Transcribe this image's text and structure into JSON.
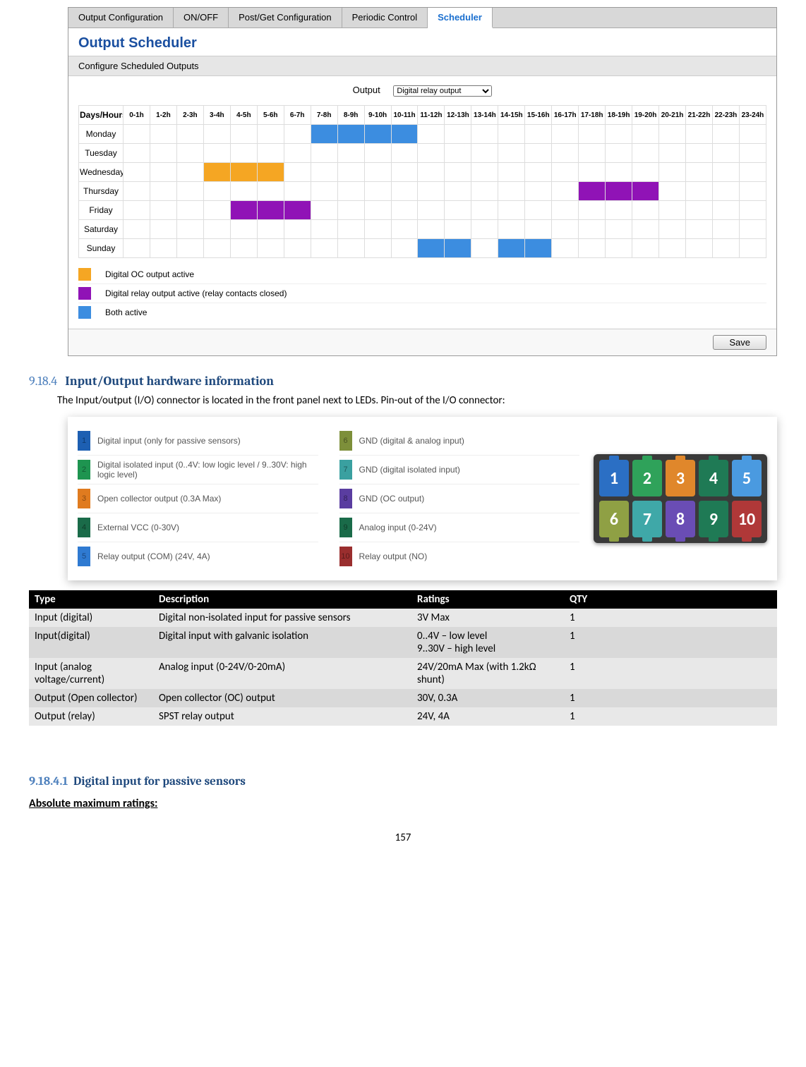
{
  "tabs": [
    "Output Configuration",
    "ON/OFF",
    "Post/Get Configuration",
    "Periodic Control",
    "Scheduler"
  ],
  "activeTab": 4,
  "schedTitle": "Output Scheduler",
  "schedSub": "Configure Scheduled Outputs",
  "outputLabel": "Output",
  "outputSelected": "Digital relay output",
  "gridCorner": "Days/Hours",
  "hours": [
    "0-1h",
    "1-2h",
    "2-3h",
    "3-4h",
    "4-5h",
    "5-6h",
    "6-7h",
    "7-8h",
    "8-9h",
    "9-10h",
    "10-11h",
    "11-12h",
    "12-13h",
    "13-14h",
    "14-15h",
    "15-16h",
    "16-17h",
    "17-18h",
    "18-19h",
    "19-20h",
    "20-21h",
    "21-22h",
    "22-23h",
    "23-24h"
  ],
  "days": [
    "Monday",
    "Tuesday",
    "Wednesday",
    "Thursday",
    "Friday",
    "Saturday",
    "Sunday"
  ],
  "cells": {
    "Monday": {
      "7": "both",
      "8": "both",
      "9": "both",
      "10": "both"
    },
    "Tuesday": {},
    "Wednesday": {
      "3": "oc",
      "4": "oc",
      "5": "oc"
    },
    "Thursday": {
      "17": "relay",
      "18": "relay",
      "19": "relay"
    },
    "Friday": {
      "4": "relay",
      "5": "relay",
      "6": "relay"
    },
    "Saturday": {},
    "Sunday": {
      "11": "both",
      "12": "both",
      "14": "both",
      "15": "both"
    }
  },
  "legend": [
    {
      "cls": "c-oc",
      "txt": "Digital OC output active"
    },
    {
      "cls": "c-relay",
      "txt": "Digital relay output active (relay contacts closed)"
    },
    {
      "cls": "c-both",
      "txt": "Both active"
    }
  ],
  "saveBtn": "Save",
  "sec": {
    "num": "9.18.4",
    "title": "Input/Output hardware information"
  },
  "para": "The Input/output (I/O) connector is located in the front panel next to LEDs. Pin-out of the I/O connector:",
  "pinsLeft": [
    {
      "n": "1",
      "c": "top",
      "t": "Digital input (only for passive sensors)"
    },
    {
      "n": "2",
      "c": "green",
      "t": "Digital isolated input (0..4V: low logic level / 9..30V: high logic level)"
    },
    {
      "n": "3",
      "c": "orange",
      "t": "Open collector output (0.3A Max)"
    },
    {
      "n": "4",
      "c": "dgreen",
      "t": "External VCC (0-30V)"
    },
    {
      "n": "5",
      "c": "blue2",
      "t": "Relay output (COM) (24V, 4A)"
    }
  ],
  "pinsRight": [
    {
      "n": "6",
      "c": "olive",
      "t": "GND (digital & analog input)"
    },
    {
      "n": "7",
      "c": "teal",
      "t": "GND (digital isolated input)"
    },
    {
      "n": "8",
      "c": "purple",
      "t": "GND (OC output)"
    },
    {
      "n": "9",
      "c": "dgreen",
      "t": "Analog input (0-24V)"
    },
    {
      "n": "10",
      "c": "red",
      "t": "Relay output (NO)"
    }
  ],
  "connTop": [
    {
      "n": "1",
      "c": "cp-b"
    },
    {
      "n": "2",
      "c": "cp-g"
    },
    {
      "n": "3",
      "c": "cp-o"
    },
    {
      "n": "4",
      "c": "cp-dg"
    },
    {
      "n": "5",
      "c": "cp-lb"
    }
  ],
  "connBot": [
    {
      "n": "6",
      "c": "cp-ol"
    },
    {
      "n": "7",
      "c": "cp-t"
    },
    {
      "n": "8",
      "c": "cp-p"
    },
    {
      "n": "9",
      "c": "cp-dg"
    },
    {
      "n": "10",
      "c": "cp-r"
    }
  ],
  "specHead": [
    "Type",
    "Description",
    "Ratings",
    "QTY"
  ],
  "specRows": [
    [
      "Input (digital)",
      "Digital non-isolated input for passive sensors",
      "3V Max",
      "1"
    ],
    [
      "Input(digital)",
      "Digital input with galvanic  isolation",
      "0..4V – low level\n9..30V – high level",
      "1"
    ],
    [
      "Input (analog voltage/current)",
      "Analog input (0-24V/0-20mA)",
      "24V/20mA Max (with 1.2kΩ shunt)",
      "1"
    ],
    [
      "Output (Open collector)",
      "Open collector (OC) output",
      "30V, 0.3A",
      "1"
    ],
    [
      "Output (relay)",
      "SPST relay output",
      "24V, 4A",
      "1"
    ]
  ],
  "sub": {
    "num": "9.18.4.1",
    "title": "Digital input for passive sensors"
  },
  "abs": "Absolute maximum ratings:",
  "pg": "157"
}
